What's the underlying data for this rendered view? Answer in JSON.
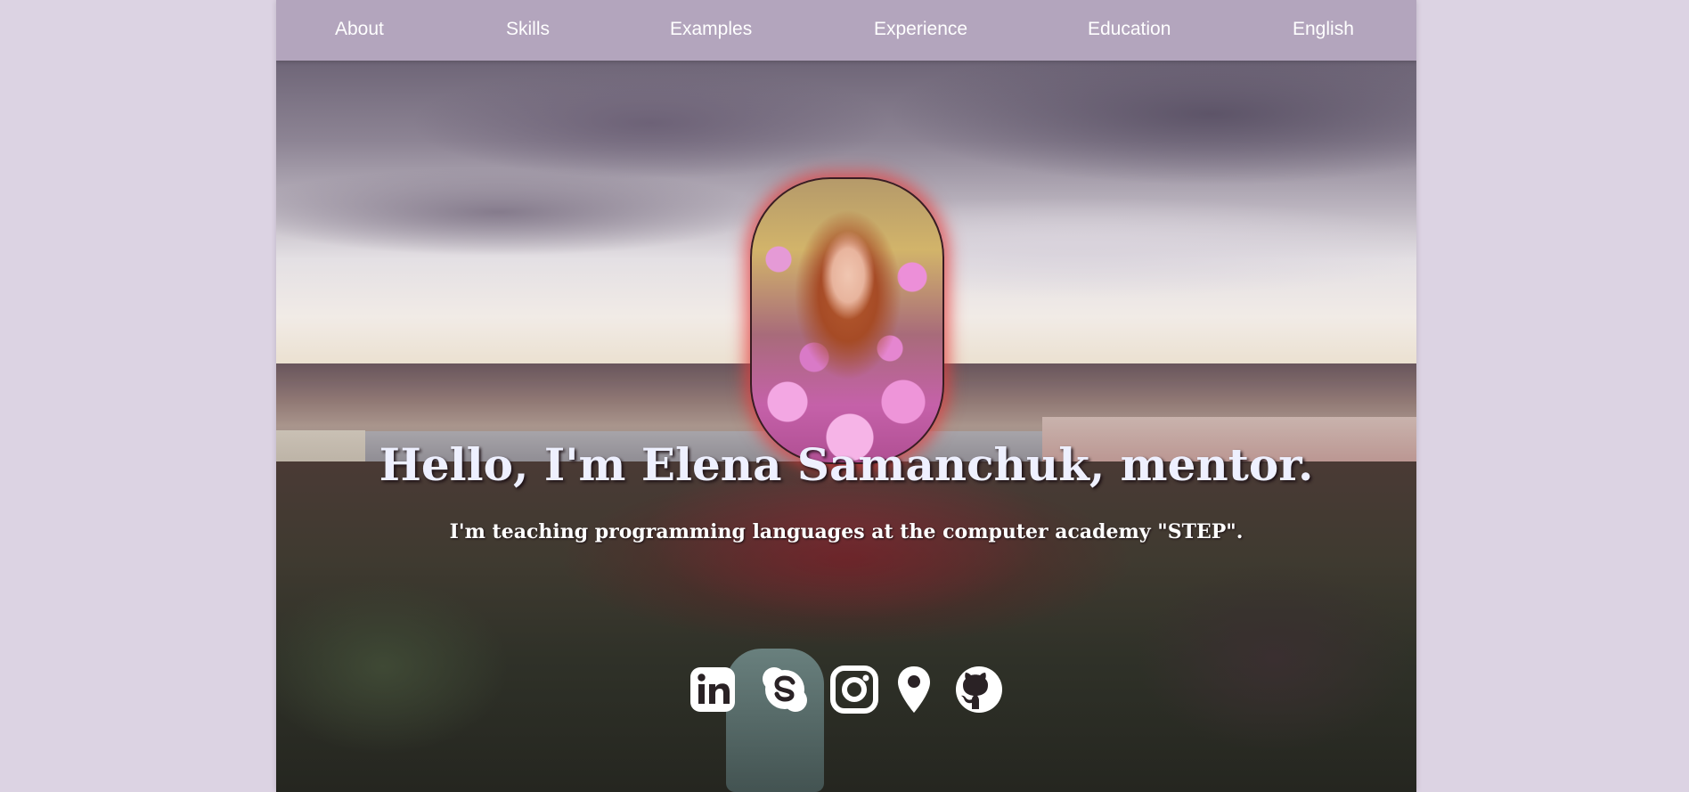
{
  "nav": {
    "items": [
      "About",
      "Skills",
      "Examples",
      "Experience",
      "Education",
      "English"
    ]
  },
  "hero": {
    "headline": "Hello, I'm Elena Samanchuk, mentor.",
    "subline": "I'm teaching programming languages at the computer academy \"STEP\"."
  },
  "social": {
    "icons": [
      "linkedin-icon",
      "skype-icon",
      "instagram-icon",
      "location-pin-icon",
      "github-icon"
    ]
  },
  "colors": {
    "page_background": "#dcd3e3",
    "nav_background": "#b3a5bd",
    "nav_text": "#ffffff",
    "headline_text": "#eef0ff",
    "avatar_glow": "#e63c3c"
  }
}
